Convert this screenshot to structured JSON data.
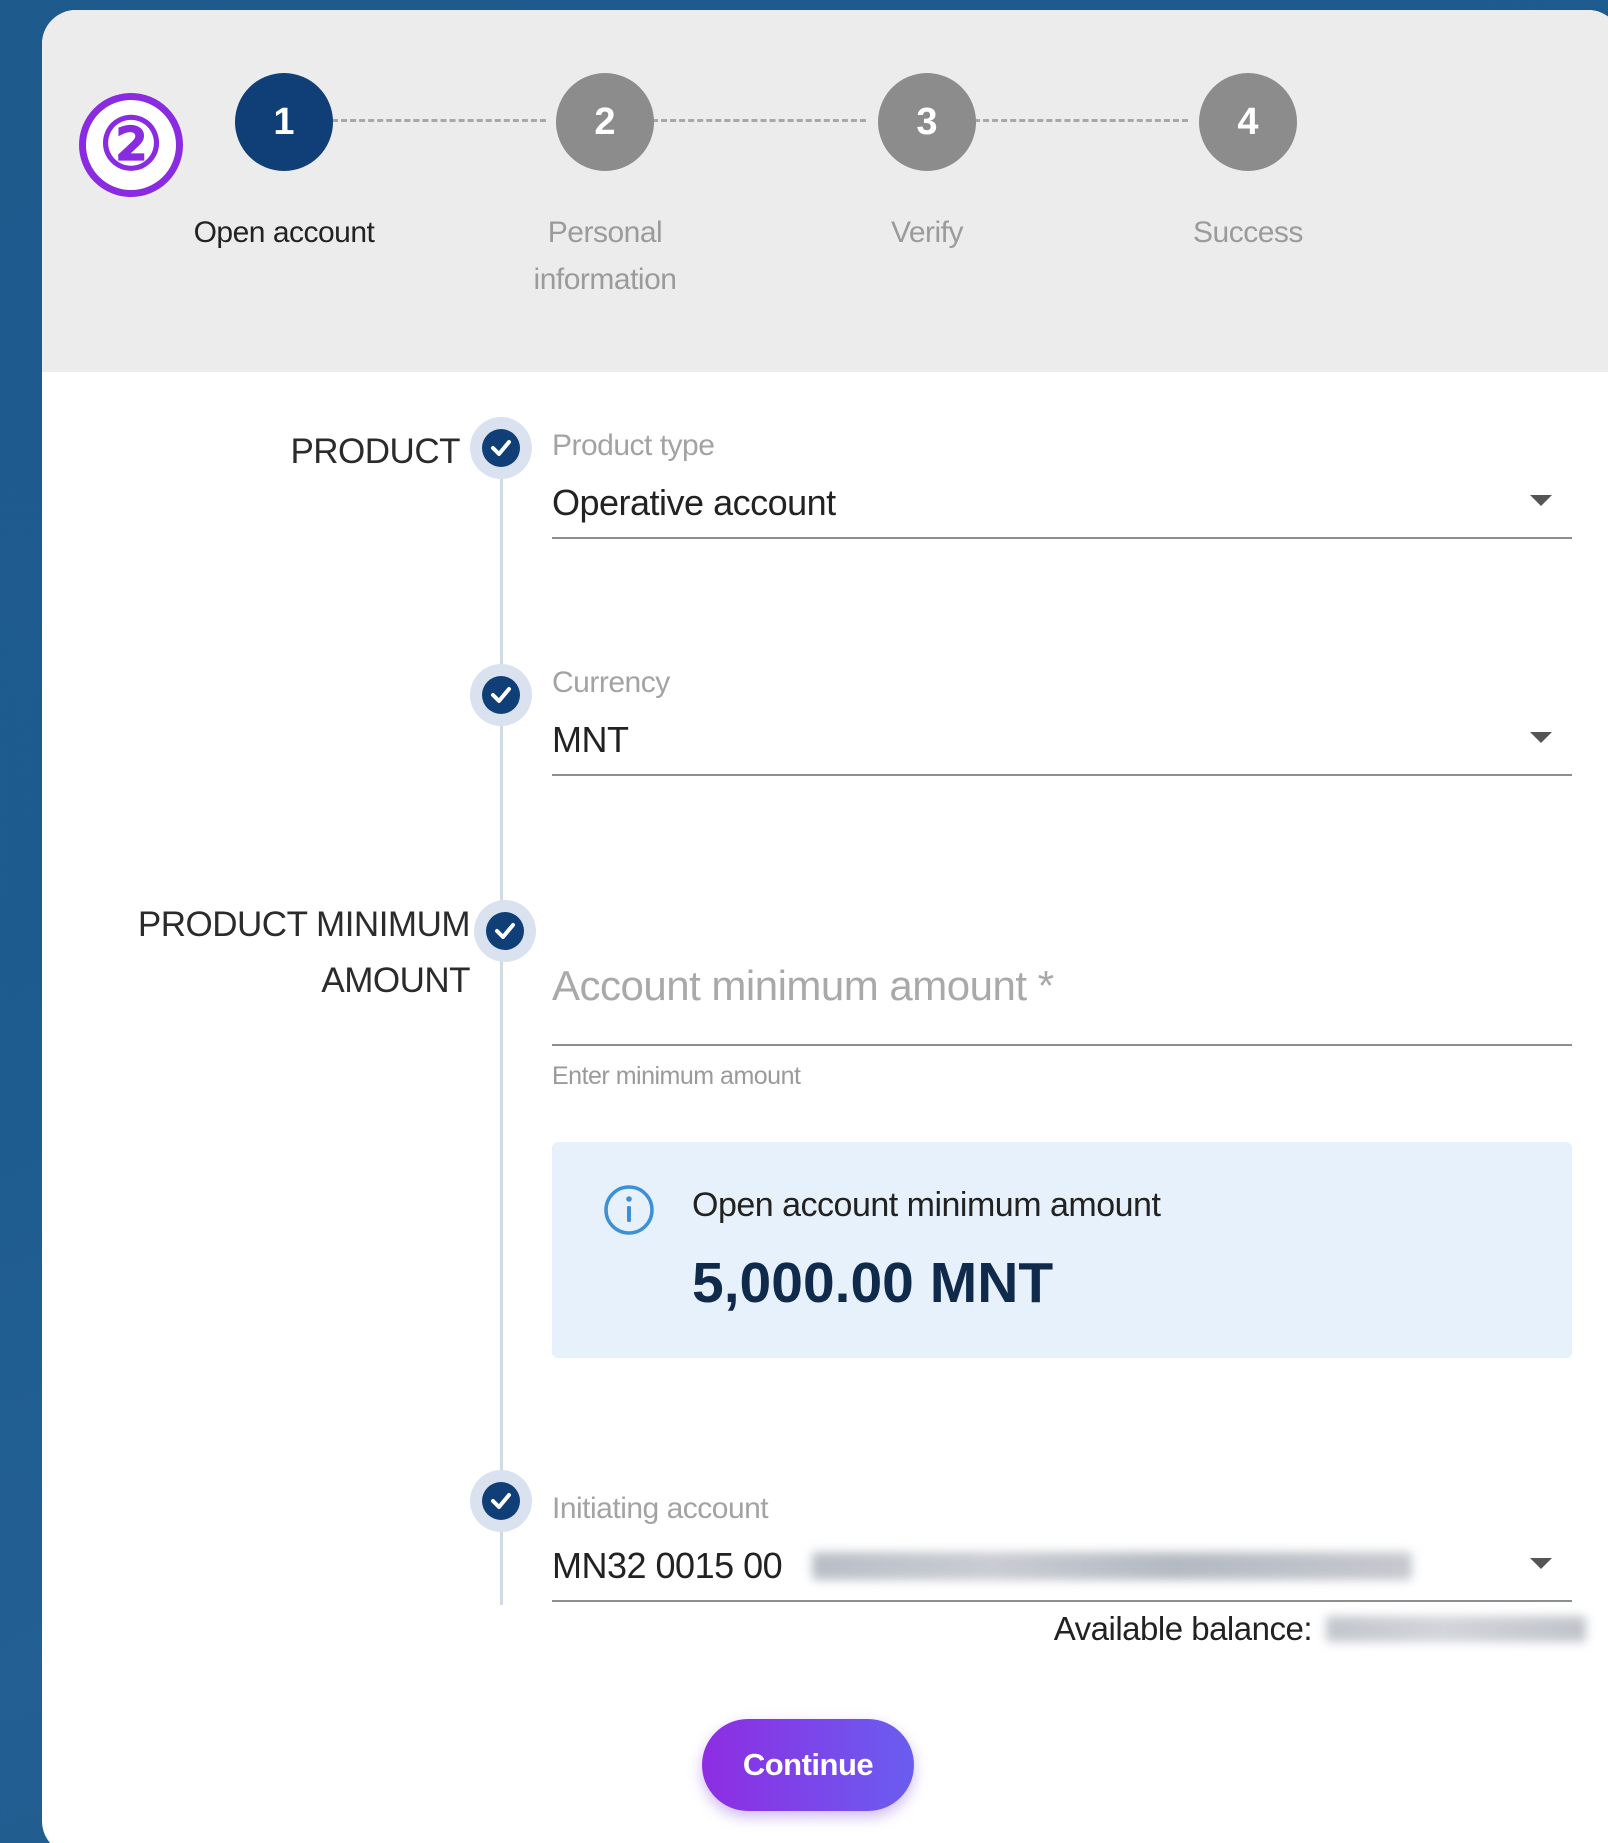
{
  "annotation": {
    "marker": "②"
  },
  "stepper": {
    "steps": [
      {
        "number": "1",
        "label": "Open account",
        "state": "active"
      },
      {
        "number": "2",
        "label": "Personal information",
        "state": "inactive"
      },
      {
        "number": "3",
        "label": "Verify",
        "state": "inactive"
      },
      {
        "number": "4",
        "label": "Success",
        "state": "inactive"
      }
    ]
  },
  "sections": {
    "product": "PRODUCT",
    "minimum_amount_line1": "PRODUCT MINIMUM",
    "minimum_amount_line2": "AMOUNT"
  },
  "form": {
    "product_type": {
      "label": "Product type",
      "value": "Operative account"
    },
    "currency": {
      "label": "Currency",
      "value": "MNT"
    },
    "minimum_amount": {
      "placeholder": "Account minimum amount *",
      "helper": "Enter minimum amount"
    },
    "info": {
      "title": "Open account minimum amount",
      "amount": "5,000.00 MNT"
    },
    "initiating_account": {
      "label": "Initiating account",
      "value_visible": "MN32 0015 00"
    },
    "available_balance_label": "Available balance:"
  },
  "actions": {
    "continue_label": "Continue"
  },
  "colors": {
    "active_step": "#0f3f76",
    "inactive_step": "#8c8c8c",
    "accent_purple": "#8a2be2",
    "info_background": "#e6f1fb"
  }
}
